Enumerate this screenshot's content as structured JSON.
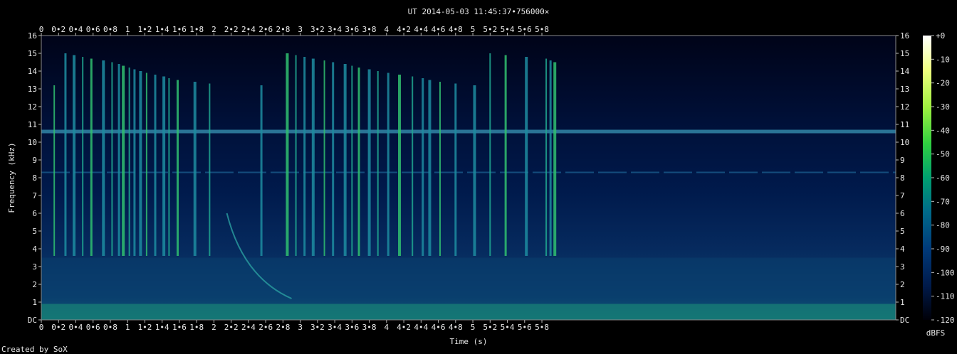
{
  "chart_data": {
    "type": "heatmap",
    "title": "UT 2014-05-03 11:45:37•756000×",
    "xlabel": "Time (s)",
    "ylabel": "Frequency (kHz)",
    "xlim": [
      0,
      9.9
    ],
    "ylim": [
      0,
      16
    ],
    "x_ticks": [
      0,
      0.2,
      0.4,
      0.6,
      0.8,
      1,
      1.2,
      1.4,
      1.6,
      1.8,
      2,
      2.2,
      2.4,
      2.6,
      2.8,
      3,
      3.2,
      3.4,
      3.6,
      3.8,
      4,
      4.2,
      4.4,
      4.6,
      4.8,
      5,
      5.2,
      5.4,
      5.6,
      5.8
    ],
    "x_tick_labels": [
      "0",
      "0•2",
      "0•4",
      "0•6",
      "0•8",
      "1",
      "1•2",
      "1•4",
      "1•6",
      "1•8",
      "2",
      "2•2",
      "2•4",
      "2•6",
      "2•8",
      "3",
      "3•2",
      "3•4",
      "3•6",
      "3•8",
      "4",
      "4•2",
      "4•4",
      "4•6",
      "4•8",
      "5",
      "5•2",
      "5•4",
      "5•6",
      "5•8"
    ],
    "y_ticks": [
      0,
      1,
      2,
      3,
      4,
      5,
      6,
      7,
      8,
      9,
      10,
      11,
      12,
      13,
      14,
      15,
      16
    ],
    "y_tick_labels": [
      "DC",
      "1",
      "2",
      "3",
      "4",
      "5",
      "6",
      "7",
      "8",
      "9",
      "10",
      "11",
      "12",
      "13",
      "14",
      "15",
      "16"
    ],
    "colorbar": {
      "label": "dBFS",
      "range": [
        -120,
        0
      ],
      "ticks": [
        0,
        -10,
        -20,
        -30,
        -40,
        -50,
        -60,
        -70,
        -80,
        -90,
        -100,
        -110,
        -120
      ],
      "tick_labels": [
        "+0",
        "-10",
        "-20",
        "-30",
        "-40",
        "-50",
        "-60",
        "-70",
        "-80",
        "-90",
        "-100",
        "-110",
        "-120"
      ],
      "colors": [
        "#000008",
        "#001a4a",
        "#003a7a",
        "#006a8a",
        "#00a070",
        "#30d040",
        "#a0f040",
        "#f0ff80",
        "#ffffff"
      ]
    },
    "features": {
      "hum_line_khz": 10.6,
      "secondary_line_khz": 8.3,
      "low_band_khz": [
        0,
        3.5
      ],
      "impulses_s": [
        0.15,
        0.28,
        0.38,
        0.48,
        0.58,
        0.72,
        0.82,
        0.9,
        0.95,
        1.02,
        1.08,
        1.15,
        1.22,
        1.32,
        1.42,
        1.48,
        1.58,
        1.78,
        1.95,
        2.55,
        2.85,
        2.95,
        3.05,
        3.15,
        3.28,
        3.38,
        3.52,
        3.6,
        3.68,
        3.8,
        3.9,
        4.02,
        4.15,
        4.3,
        4.42,
        4.5,
        4.62,
        4.8,
        5.02,
        5.2,
        5.38,
        5.62,
        5.85,
        5.9,
        5.95
      ],
      "chirp": {
        "start_s": 2.15,
        "end_s": 2.9,
        "start_khz": 6.0,
        "end_khz": 1.2
      }
    }
  },
  "footer": {
    "credit": "Created by SoX"
  }
}
